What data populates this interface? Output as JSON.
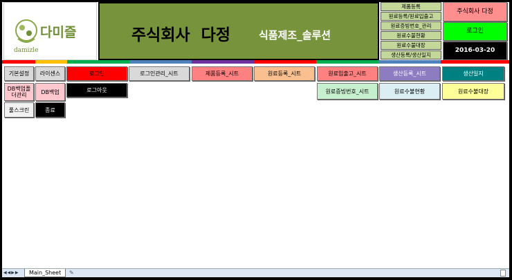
{
  "logo": {
    "text": "다미즐",
    "sub": "damizle"
  },
  "banner": {
    "title": "주식회사  다정",
    "subtitle": "식품제조_솔루션"
  },
  "menu": [
    "제품등록",
    "원료등록/원료입출고",
    "원료증빙번호_관리",
    "원료수불현황",
    "원료수불대장",
    "생산등록/생산일지"
  ],
  "side": {
    "company": "주식회사 다정",
    "login": "로그인",
    "date": "2016-03-20"
  },
  "buttons": {
    "basic": "기본설정",
    "license": "라이센스",
    "login": "로그인",
    "login_sheet": "로그인관리_시트",
    "product_sheet": "제품등록_시트",
    "material_sheet": "원료등록_시트",
    "inout_sheet": "원료입출고_시트",
    "production_sheet": "생산등록_시트",
    "production_log": "생산일지",
    "db_folder": "DB백업폴더관리",
    "db_backup": "DB백업",
    "logout": "로그아웃",
    "evidence_sheet": "원료증빙번호_시트",
    "status": "원료수불현황",
    "ledger": "원료수불대장",
    "fullscreen": "풀스크린",
    "exit": "종료"
  },
  "tabs": {
    "sheet": "Main_Sheet"
  }
}
